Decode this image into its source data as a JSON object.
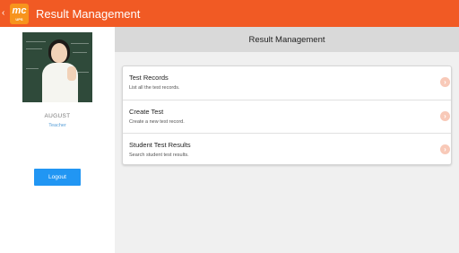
{
  "appbar": {
    "back_glyph": "‹",
    "logo_mark": "mc",
    "logo_sub": "UPS",
    "title": "Result Management"
  },
  "sidebar": {
    "username": "AUGUST",
    "role": "Teacher",
    "logout_label": "Logout"
  },
  "main": {
    "header_title": "Result Management",
    "items": [
      {
        "title": "Test Records",
        "description": "List all the test records.",
        "icon": "chevron-right-icon"
      },
      {
        "title": "Create Test",
        "description": "Create a new test record.",
        "icon": "chevron-right-icon"
      },
      {
        "title": "Student Test Results",
        "description": "Search student test results.",
        "icon": "chevron-right-icon"
      }
    ],
    "chevron_glyph": "›"
  },
  "colors": {
    "accent": "#f15a24",
    "button": "#2196f3",
    "header_bg": "#d9d9d9"
  }
}
